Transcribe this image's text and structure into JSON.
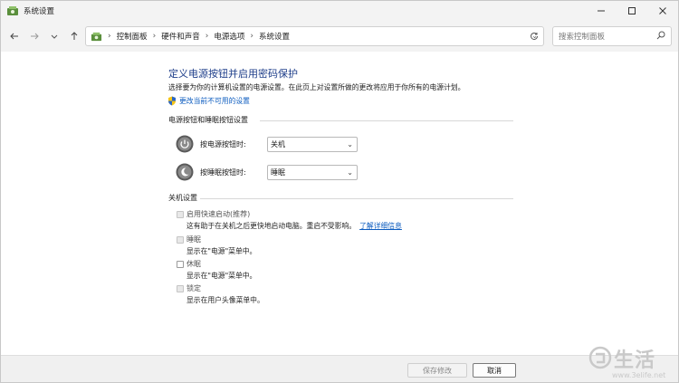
{
  "window": {
    "title": "系统设置"
  },
  "nav": {
    "breadcrumbs": [
      "控制面板",
      "硬件和声音",
      "电源选项",
      "系统设置"
    ],
    "search_placeholder": "搜索控制面板"
  },
  "main": {
    "title": "定义电源按钮并启用密码保护",
    "description": "选择要为你的计算机设置的电源设置。在此页上对设置所做的更改将应用于你所有的电源计划。",
    "change_link": "更改当前不可用的设置",
    "power_section": {
      "heading": "电源按钮和睡眠按钮设置",
      "rows": [
        {
          "label": "按电源按钮时:",
          "value": "关机"
        },
        {
          "label": "按睡眠按钮时:",
          "value": "睡眠"
        }
      ]
    },
    "shutdown_section": {
      "heading": "关机设置",
      "options": [
        {
          "label": "启用快速启动(推荐)",
          "desc": "这有助于在关机之后更快地启动电脑。重启不受影响。",
          "link": "了解详细信息"
        },
        {
          "label": "睡眠",
          "desc": "显示在\"电源\"菜单中。"
        },
        {
          "label": "休眠",
          "desc": "显示在\"电源\"菜单中。"
        },
        {
          "label": "锁定",
          "desc": "显示在用户头像菜单中。"
        }
      ]
    }
  },
  "footer": {
    "save_label": "保存修改",
    "cancel_label": "取消"
  },
  "watermark": {
    "text": "生活",
    "url": "www.3elife.net"
  },
  "colors": {
    "accent_link": "#0b5bbf",
    "title_blue": "#1e3e8a"
  }
}
